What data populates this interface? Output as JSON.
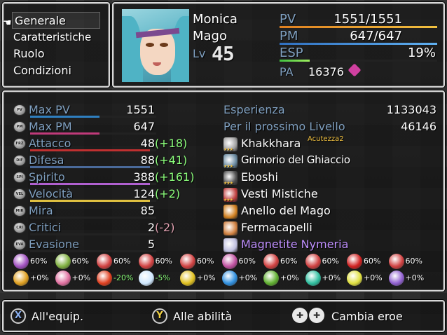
{
  "menu": {
    "items": [
      {
        "label": "Generale",
        "selected": true
      },
      {
        "label": "Caratteristiche"
      },
      {
        "label": "Ruolo"
      },
      {
        "label": "Condizioni"
      }
    ],
    "cursor_icon": "pointing-hand-icon"
  },
  "actor": {
    "name": "Monica",
    "class": "Mago",
    "level_label": "Lv",
    "level": "45",
    "hp_label": "PV",
    "hp": "1551/1551",
    "hp_fraction": 1.0,
    "mp_label": "PM",
    "mp": "647/647",
    "mp_fraction": 1.0,
    "exp_label": "ESP",
    "exp": "19%",
    "exp_fraction": 0.19,
    "ap_label": "PA",
    "ap": "16376"
  },
  "stats": [
    {
      "icon": "PV",
      "name": "Max PV",
      "value": "1551",
      "bonus": "",
      "bar_color": "#2f7fc0",
      "fill": 0.55
    },
    {
      "icon": "PM",
      "name": "Max PM",
      "value": "647",
      "bonus": "",
      "bar_color": "#c03a7a",
      "fill": 0.55
    },
    {
      "icon": "FRZ",
      "name": "Attacco",
      "value": "48",
      "bonus": "(+18)",
      "bonus_color": "#8cff7c",
      "bar_color": "#c03030",
      "fill": 0.95
    },
    {
      "icon": "DIF",
      "name": "Difesa",
      "value": "88",
      "bonus": "(+41)",
      "bonus_color": "#8cff7c",
      "bar_color": "#4a6a9a",
      "fill": 0.95
    },
    {
      "icon": "SPI",
      "name": "Spirito",
      "value": "388",
      "bonus": "(+161)",
      "bonus_color": "#8cff7c",
      "bar_color": "#b060d0",
      "fill": 0.95
    },
    {
      "icon": "VEL",
      "name": "Velocità",
      "value": "124",
      "bonus": "(+2)",
      "bonus_color": "#8cff7c",
      "bar_color": "#e0c040",
      "fill": 0.95
    },
    {
      "icon": "MIR",
      "name": "Mira",
      "value": "85",
      "bonus": "",
      "bar_color": "#2a2a2a",
      "fill": 0
    },
    {
      "icon": "CRI",
      "name": "Critici",
      "value": "2",
      "bonus": "(-2)",
      "bonus_color": "#e0a0b0",
      "bar_color": "#2a2a2a",
      "fill": 0
    },
    {
      "icon": "EVA",
      "name": "Evasione",
      "value": "5",
      "bonus": "",
      "bar_color": "#2a2a2a",
      "fill": 0
    }
  ],
  "experience": {
    "exp_label": "Esperienza",
    "exp_value": "1133043",
    "next_label": "Per il prossimo Livello",
    "next_value": "46146"
  },
  "equipment": [
    {
      "name": "Khakkhara",
      "extra": "Acutezza2",
      "icon": "staff-icon",
      "stars": "★★★",
      "color": "#ffffff"
    },
    {
      "name": "Grimorio del Ghiaccio",
      "icon": "book-icon",
      "stars": "★★★",
      "color": "#ffffff"
    },
    {
      "name": "Eboshi",
      "icon": "hat-icon",
      "stars": "★★★",
      "color": "#ffffff"
    },
    {
      "name": "Vesti Mistiche",
      "icon": "robe-icon",
      "stars": "★★★",
      "color": "#ffffff"
    },
    {
      "name": "Anello del Mago",
      "icon": "ring-icon",
      "stars": "",
      "color": "#ffffff"
    },
    {
      "name": "Fermacapelli",
      "icon": "hairpin-icon",
      "stars": "",
      "color": "#ffffff"
    },
    {
      "name": "Magnetite Nymeria",
      "icon": "orb-icon",
      "stars": "",
      "color": "#c090ff"
    }
  ],
  "status_resist": [
    {
      "icon": "poison-icon",
      "value": "60%",
      "color": "#a050c0"
    },
    {
      "icon": "blind-icon",
      "value": "60%",
      "color": "#80b040"
    },
    {
      "icon": "silence-icon",
      "value": "60%",
      "color": "#d04040"
    },
    {
      "icon": "confusion-icon",
      "value": "60%",
      "color": "#d04040"
    },
    {
      "icon": "question-icon",
      "value": "60%",
      "color": "#d04040"
    },
    {
      "icon": "sleep-icon",
      "value": "60%",
      "color": "#c050a0"
    },
    {
      "icon": "stop-icon",
      "value": "60%",
      "color": "#d04040"
    },
    {
      "icon": "burst-icon",
      "value": "60%",
      "color": "#d04040"
    },
    {
      "icon": "berry-icon",
      "value": "60%",
      "color": "#d02020"
    },
    {
      "icon": "death-icon",
      "value": "60%",
      "color": "#d04040"
    }
  ],
  "element_resist": [
    {
      "icon": "yin-yang-icon",
      "value": "+0%",
      "color": "#e0a020"
    },
    {
      "icon": "heart-icon",
      "value": "+0%",
      "color": "#e070a0"
    },
    {
      "icon": "fire-icon",
      "value": "-20%",
      "color": "#e04020",
      "value_color": "#8cff7c"
    },
    {
      "icon": "ice-icon",
      "value": "-5%",
      "color": "#d0e8ff",
      "value_color": "#8cff7c"
    },
    {
      "icon": "thunder-icon",
      "value": "+0%",
      "color": "#e0c020"
    },
    {
      "icon": "water-icon",
      "value": "+0%",
      "color": "#3090e0"
    },
    {
      "icon": "leaf-icon",
      "value": "+0%",
      "color": "#60b030"
    },
    {
      "icon": "wind-icon",
      "value": "+0%",
      "color": "#30c0a0"
    },
    {
      "icon": "light-icon",
      "value": "+0%",
      "color": "#e0e040"
    },
    {
      "icon": "moon-icon",
      "value": "+0%",
      "color": "#9060d0"
    }
  ],
  "help": {
    "equip_button": "X",
    "equip_label": "All'equip.",
    "skills_button": "Y",
    "skills_label": "Alle abilità",
    "switch_label": "Cambia eroe"
  }
}
